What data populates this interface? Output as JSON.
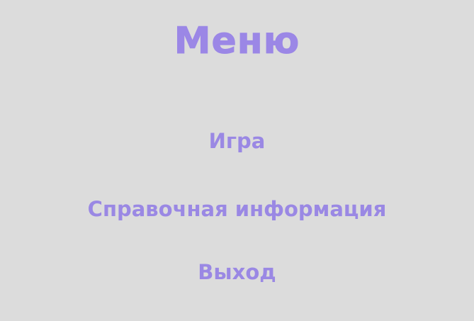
{
  "colors": {
    "background": "#dcdcdc",
    "title": "#9b87e6",
    "item": "#9a88e4"
  },
  "menu": {
    "title": "Меню",
    "items": [
      {
        "label": "Игра"
      },
      {
        "label": "Справочная информация"
      },
      {
        "label": "Выход"
      }
    ]
  }
}
